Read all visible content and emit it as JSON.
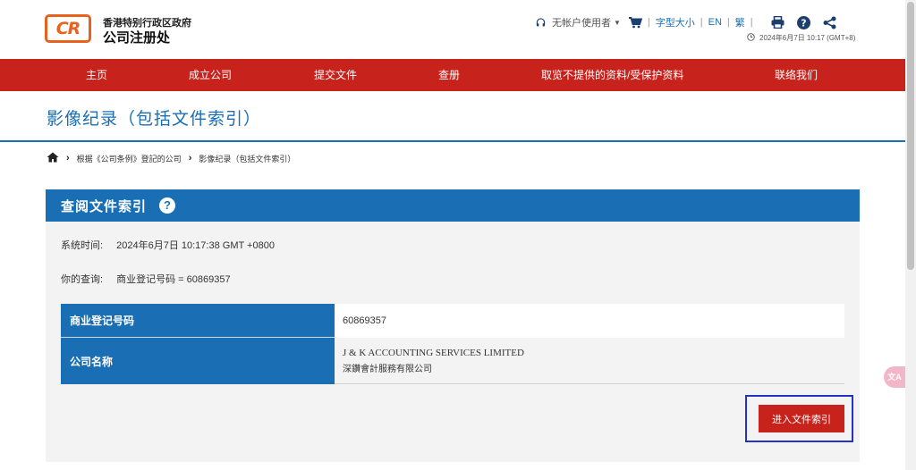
{
  "header": {
    "logo_text": "CR",
    "org_line1": "香港特别行政区政府",
    "org_line2": "公司注册处",
    "user_label": "无帐户使用者",
    "font_size_label": "字型大小",
    "lang_en": "EN",
    "lang_trad": "繁",
    "datetime": "2024年6月7日 10:17 (GMT+8)",
    "icons": [
      "user-icon",
      "cart-icon",
      "print-icon",
      "help-icon",
      "share-icon",
      "clock-icon"
    ]
  },
  "nav": {
    "items": [
      "主页",
      "成立公司",
      "提交文件",
      "查册",
      "取览不提供的资料/受保护资料",
      "联络我们"
    ]
  },
  "page": {
    "title": "影像纪录（包括文件索引）",
    "breadcrumb": [
      "根据《公司条例》登記的公司",
      "影像纪录（包括文件索引）"
    ]
  },
  "panel": {
    "title": "查阅文件索引",
    "system_time_label": "系统时间:",
    "system_time_value": "2024年6月7日 10:17:38 GMT +0800",
    "query_label": "你的查询:",
    "query_value": "商业登记号码 = 60869357",
    "rows": [
      {
        "label": "商业登记号码",
        "value": "60869357"
      },
      {
        "label": "公司名称",
        "value_en": "J & K ACCOUNTING SERVICES LIMITED",
        "value_zh": "深鑽會計服務有限公司"
      }
    ],
    "enter_button": "进入文件索引"
  },
  "colors": {
    "brand_orange": "#e8611d",
    "nav_red": "#c8221c",
    "primary_blue": "#1a6fb4",
    "highlight_frame": "#2432c8"
  }
}
